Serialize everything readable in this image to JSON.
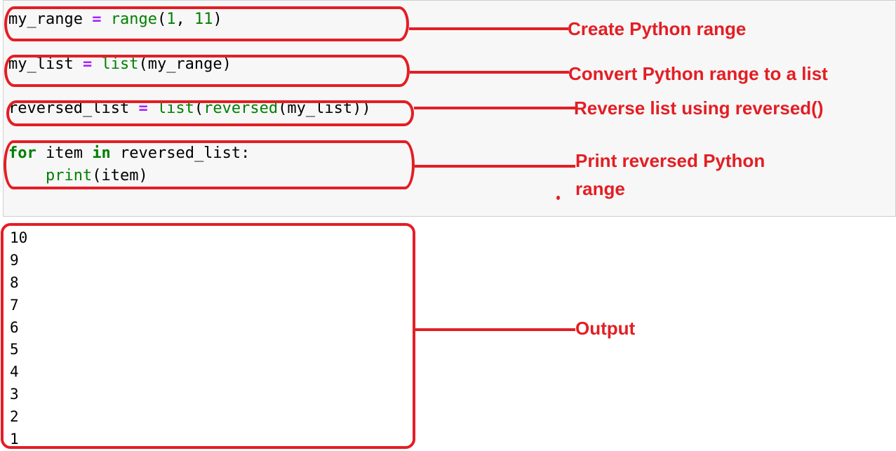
{
  "code_cell": {
    "lines": [
      {
        "var": "my_range",
        "op": "=",
        "builtin": "range",
        "open": "(",
        "arg1": "1",
        "sep": ", ",
        "arg2": "11",
        "close": ")"
      },
      {
        "var": "my_list",
        "op": "=",
        "builtin": "list",
        "rest": "(my_range)"
      },
      {
        "var": "reversed_list",
        "op": "=",
        "builtin1": "list",
        "paren": "(",
        "builtin2": "reversed",
        "rest": "(my_list))"
      },
      {
        "kw1": "for",
        "mid1": " item ",
        "kw2": "in",
        "rest": " reversed_list:"
      },
      {
        "indent": "    ",
        "builtin": "print",
        "rest": "(item)"
      }
    ]
  },
  "output": {
    "values": [
      "10",
      "9",
      "8",
      "7",
      "6",
      "5",
      "4",
      "3",
      "2",
      "1"
    ]
  },
  "annotations": [
    {
      "label": "Create Python range"
    },
    {
      "label": "Convert Python range to a list"
    },
    {
      "label": "Reverse list using reversed()"
    },
    {
      "label_line1": "Print reversed Python",
      "label_line2": "range"
    },
    {
      "label": "Output"
    }
  ],
  "colors": {
    "annotation": "#e31e24",
    "keyword": "#008000",
    "operator": "#aa22ff",
    "cell_background": "#f7f7f7"
  }
}
